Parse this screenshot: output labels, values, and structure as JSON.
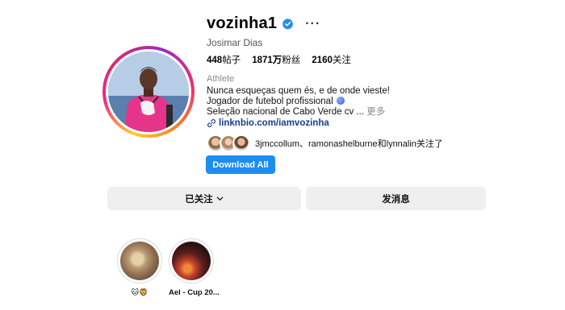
{
  "profile": {
    "username": "vozinha1",
    "full_name": "Josimar Dias",
    "verified": true,
    "more_glyph": "···",
    "stats": {
      "posts_num": "448",
      "posts_label": "帖子",
      "followers_num": "1871万",
      "followers_label": "粉丝",
      "following_num": "2160",
      "following_label": "关注"
    },
    "category": "Athlete",
    "bio": {
      "line1": "Nunca esqueças quem és, e de onde vieste!",
      "line2": "Jogador de futebol profissional",
      "line3": "Seleção nacional de Cabo Verde cv ...",
      "more": "更多"
    },
    "link": "linknbio.com/iamvozinha",
    "followed_by": "3jmccollum、ramonashelburne和lynnalin关注了"
  },
  "actions": {
    "download_label": "Download All",
    "following_label": "已关注",
    "message_label": "发消息"
  },
  "highlights": [
    {
      "label": "🐱🦁"
    },
    {
      "label": "Ael - Cup 20..."
    }
  ],
  "colors": {
    "accent": "#1d8df0",
    "link": "#1a3e8c",
    "button_bg": "#efefef"
  }
}
